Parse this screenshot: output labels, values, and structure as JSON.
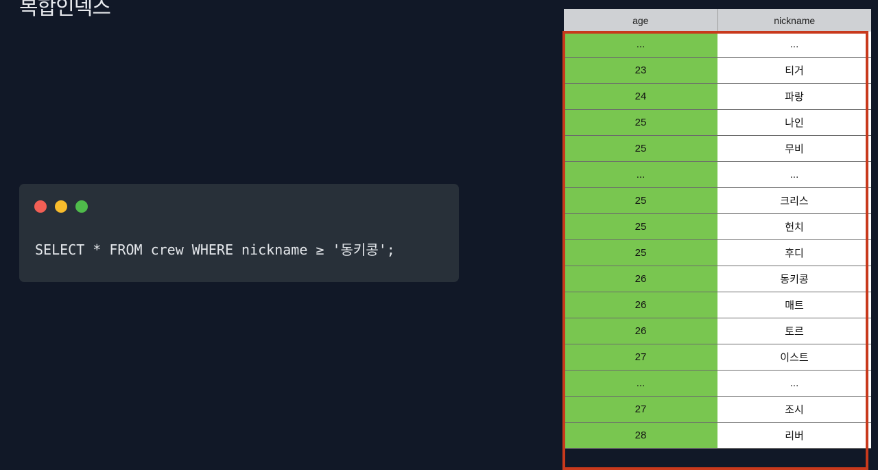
{
  "slide": {
    "title": "복합인덱스"
  },
  "code_window": {
    "dots": [
      "close-dot",
      "minimize-dot",
      "maximize-dot"
    ],
    "query": "SELECT * FROM crew WHERE nickname ≥ '동키콩';"
  },
  "table": {
    "columns": [
      "age",
      "nickname"
    ],
    "rows": [
      {
        "age": "...",
        "nickname": "..."
      },
      {
        "age": "23",
        "nickname": "티거"
      },
      {
        "age": "24",
        "nickname": "파랑"
      },
      {
        "age": "25",
        "nickname": "나인"
      },
      {
        "age": "25",
        "nickname": "무비"
      },
      {
        "age": "...",
        "nickname": "..."
      },
      {
        "age": "25",
        "nickname": "크리스"
      },
      {
        "age": "25",
        "nickname": "헌치"
      },
      {
        "age": "25",
        "nickname": "후디"
      },
      {
        "age": "26",
        "nickname": "동키콩"
      },
      {
        "age": "26",
        "nickname": "매트"
      },
      {
        "age": "26",
        "nickname": "토르"
      },
      {
        "age": "27",
        "nickname": "이스트"
      },
      {
        "age": "...",
        "nickname": "..."
      },
      {
        "age": "27",
        "nickname": "조시"
      },
      {
        "age": "28",
        "nickname": "리버"
      }
    ],
    "colors": {
      "age_highlight": "#79c650",
      "frame": "#c8391c",
      "header_bg": "#cfd1d4"
    }
  }
}
